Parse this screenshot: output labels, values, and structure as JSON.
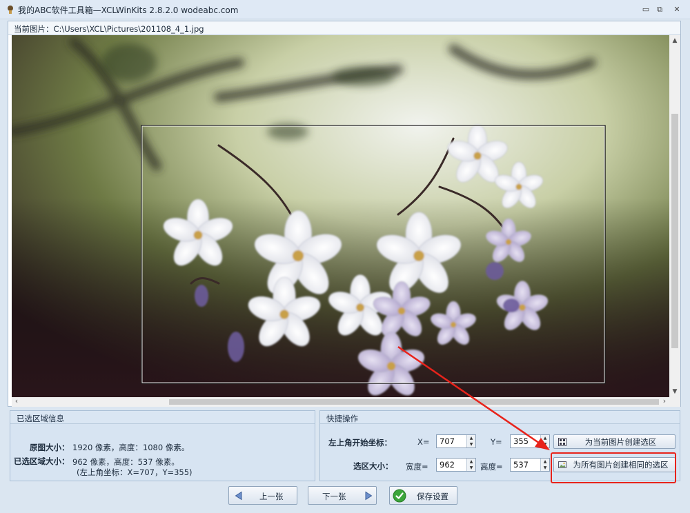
{
  "window": {
    "title": "我的ABC软件工具箱—XCLWinKits 2.8.2.0  wodeabc.com",
    "minimize_glyph": "▭",
    "restore_glyph": "⧉",
    "close_glyph": "✕"
  },
  "image_panel": {
    "path_label": "当前图片：C:\\Users\\XCL\\Pictures\\201108_4_1.jpg"
  },
  "selection_info": {
    "title": "已选区域信息",
    "original_label": "原图大小：",
    "original_value": "1920 像素，高度：1080 像素。",
    "selected_label": "已选区域大小：",
    "selected_value": "962 像素，高度：537 像素。",
    "selected_coords": "(左上角坐标：X=707，Y=355)"
  },
  "quick_ops": {
    "title": "快捷操作",
    "start_label": "左上角开始坐标：",
    "x_label": "X=",
    "x_value": "707",
    "y_label": "Y=",
    "y_value": "355",
    "size_label": "选区大小：",
    "width_label": "宽度=",
    "width_value": "962",
    "height_label": "高度=",
    "height_value": "537",
    "btn_current": "为当前图片创建选区",
    "btn_all": "为所有图片创建相同的选区"
  },
  "nav": {
    "prev": "上一张",
    "next": "下一张",
    "save": "保存设置"
  },
  "colors": {
    "highlight_red": "#e8231b",
    "window_bg": "#dbe6f1",
    "save_green": "#3aa53a"
  },
  "icons": {
    "prev": "left-arrow-icon",
    "next": "right-arrow-icon",
    "save": "checkmark-icon",
    "current_selection": "selection-grid-icon",
    "all_selection": "image-icon"
  }
}
